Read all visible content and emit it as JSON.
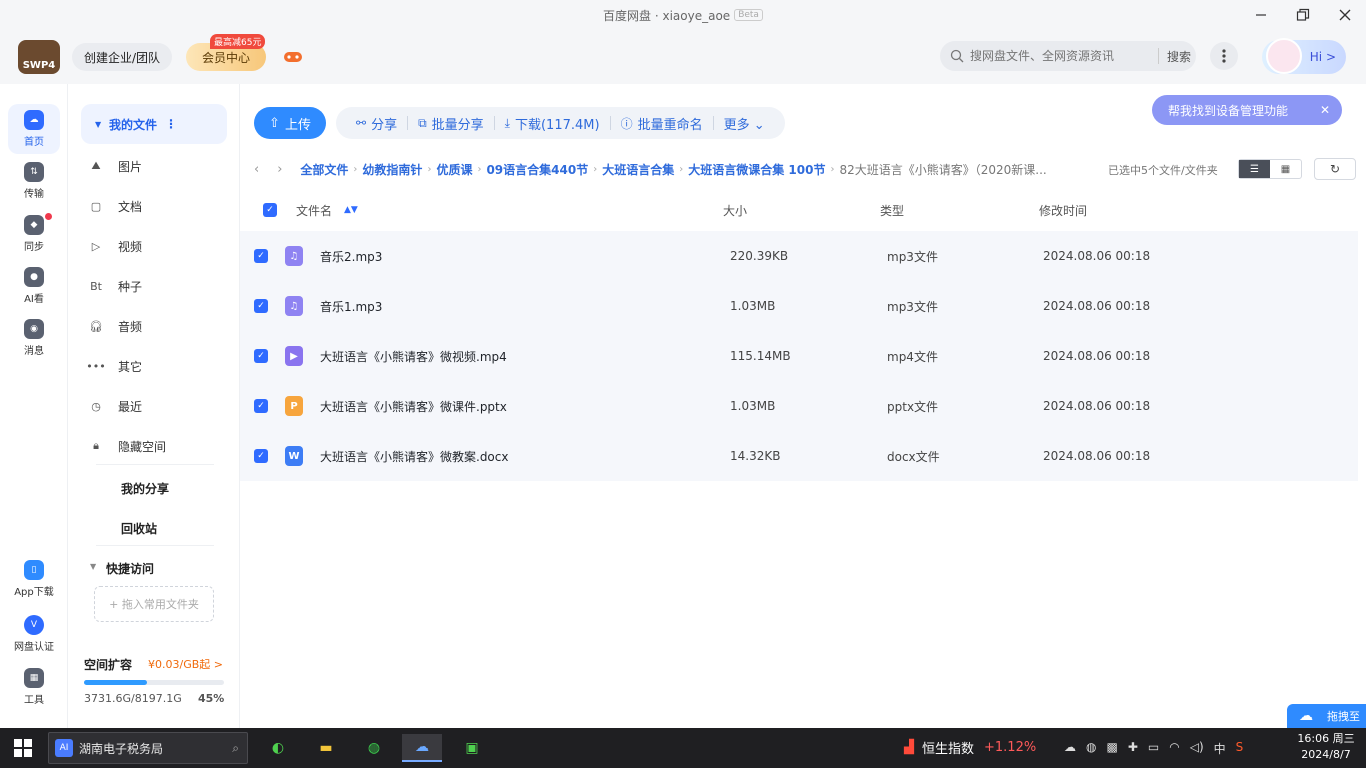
{
  "window": {
    "title": "百度网盘 · xiaoye_aoe",
    "beta": "Beta"
  },
  "header": {
    "logo_text": "SWP4",
    "enterprise": "创建企业/团队",
    "vip": "会员中心",
    "vip_badge": "最高减65元",
    "search_placeholder": "搜网盘文件、全网资源资讯",
    "search_btn": "搜索",
    "hi": "Hi >"
  },
  "rail": [
    {
      "label": "首页",
      "icon": "cloud-home-icon"
    },
    {
      "label": "传输",
      "icon": "transfer-icon"
    },
    {
      "label": "同步",
      "icon": "sync-icon"
    },
    {
      "label": "AI看",
      "icon": "ai-view-icon"
    },
    {
      "label": "消息",
      "icon": "message-icon"
    },
    {
      "label": "App下载",
      "icon": "app-download-icon"
    },
    {
      "label": "网盘认证",
      "icon": "verify-icon"
    },
    {
      "label": "工具",
      "icon": "tools-icon"
    }
  ],
  "sidebar": {
    "my_files": "我的文件",
    "items": [
      "图片",
      "文档",
      "视频",
      "种子",
      "音频",
      "其它",
      "最近",
      "隐藏空间"
    ],
    "torrent_icon_text": "Bt",
    "my_share": "我的分享",
    "recycle": "回收站",
    "quick_access": "快捷访问",
    "add_folder": "+ 拖入常用文件夹",
    "space_title": "空间扩容",
    "space_price": "¥0.03/GB起 >",
    "space_used": "3731.6G/8197.1G",
    "space_pct": "45%",
    "space_fraction": 0.45
  },
  "toolbar": {
    "upload": "上传",
    "share": "分享",
    "batch_share": "批量分享",
    "download": "下载(117.4M)",
    "batch_rename": "批量重命名",
    "more": "更多"
  },
  "help_pill": "帮我找到设备管理功能",
  "breadcrumb": [
    "全部文件",
    "幼教指南针",
    "优质课",
    "09语言合集440节",
    "大班语言合集",
    "大班语言微课合集 100节",
    "82大班语言《小熊请客》（2020新课..."
  ],
  "selected_info": "已选中5个文件/文件夹",
  "table": {
    "headers": {
      "name": "文件名",
      "size": "大小",
      "type": "类型",
      "time": "修改时间"
    },
    "rows": [
      {
        "name": "音乐2.mp3",
        "size": "220.39KB",
        "type": "mp3文件",
        "time": "2024.08.06 00:18",
        "icon": "audio-file-icon",
        "color": "#8f83f2"
      },
      {
        "name": "音乐1.mp3",
        "size": "1.03MB",
        "type": "mp3文件",
        "time": "2024.08.06 00:18",
        "icon": "audio-file-icon",
        "color": "#8f83f2"
      },
      {
        "name": "大班语言《小熊请客》微视频.mp4",
        "size": "115.14MB",
        "type": "mp4文件",
        "time": "2024.08.06 00:18",
        "icon": "video-file-icon",
        "color": "#8a74ef"
      },
      {
        "name": "大班语言《小熊请客》微课件.pptx",
        "size": "1.03MB",
        "type": "pptx文件",
        "time": "2024.08.06 00:18",
        "icon": "ppt-file-icon",
        "color": "#f7a53d"
      },
      {
        "name": "大班语言《小熊请客》微教案.docx",
        "size": "14.32KB",
        "type": "docx文件",
        "time": "2024.08.06 00:18",
        "icon": "word-file-icon",
        "color": "#3d7df5"
      }
    ]
  },
  "drag_tip": "拖拽至",
  "taskbar": {
    "search_text": "湖南电子税务局",
    "search_ai": "AI",
    "hs_name": "恒生指数",
    "hs_change": "+1.12%",
    "ime": "中",
    "time": "16:06 周三",
    "date": "2024/8/7"
  }
}
